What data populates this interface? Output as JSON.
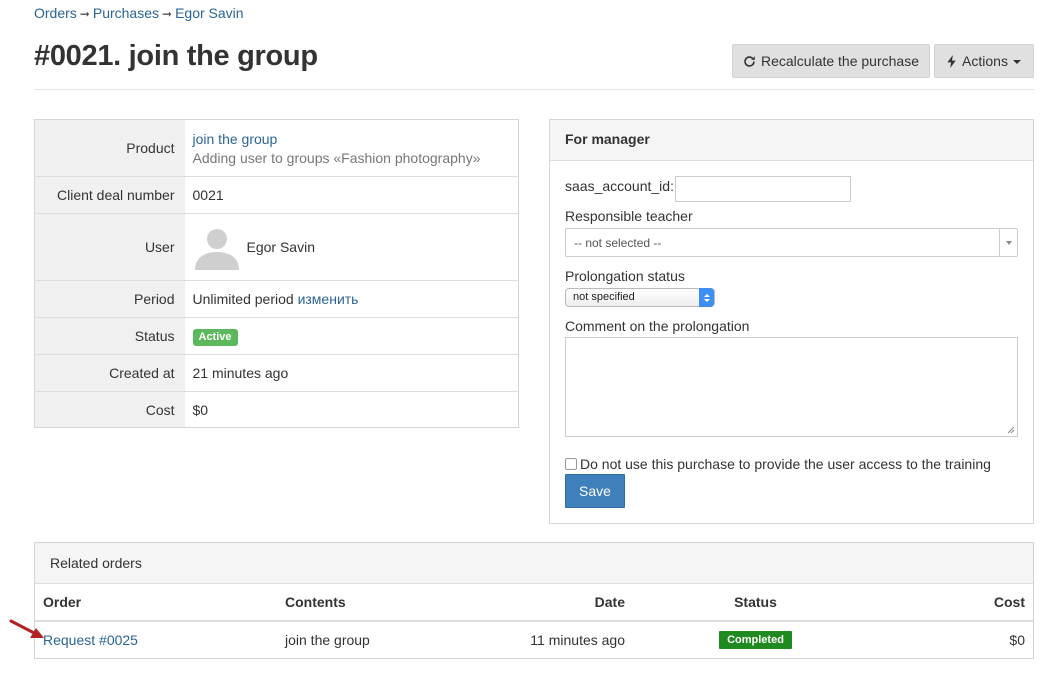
{
  "breadcrumb": {
    "items": [
      "Orders",
      "Purchases",
      "Egor Savin"
    ],
    "separator": "➞"
  },
  "page_title": "#0021. join the group",
  "header_buttons": {
    "recalculate": "Recalculate the purchase",
    "actions": "Actions"
  },
  "info": {
    "product_label": "Product",
    "product_link": "join the group",
    "product_description": "Adding user to groups «Fashion photography»",
    "deal_label": "Client deal number",
    "deal_value": "0021",
    "user_label": "User",
    "user_name": "Egor Savin",
    "period_label": "Period",
    "period_value": "Unlimited period",
    "period_change_link": "изменить",
    "status_label": "Status",
    "status_value": "Active",
    "created_label": "Created at",
    "created_value": "21 minutes ago",
    "cost_label": "Cost",
    "cost_value": "$0"
  },
  "manager": {
    "heading": "For manager",
    "saas_label": "saas_account_id:",
    "saas_value": "",
    "teacher_label": "Responsible teacher",
    "teacher_selected": "-- not selected --",
    "prolongation_label": "Prolongation status",
    "prolongation_selected": "not specified",
    "comment_label": "Comment on the prolongation",
    "comment_value": "",
    "checkbox_label": "Do not use this purchase to provide the user access to the training",
    "save_label": "Save"
  },
  "related": {
    "heading": "Related orders",
    "columns": [
      "Order",
      "Contents",
      "Date",
      "Status",
      "Cost"
    ],
    "rows": [
      {
        "order": "Request #0025",
        "contents": "join the group",
        "date": "11 minutes ago",
        "status": "Completed",
        "cost": "$0"
      }
    ]
  },
  "colors": {
    "link": "#2a6496",
    "active_badge": "#5cb85c",
    "completed_badge": "#1f8a1f",
    "primary_button": "#3f80ba",
    "annotation_arrow": "#b22222"
  }
}
